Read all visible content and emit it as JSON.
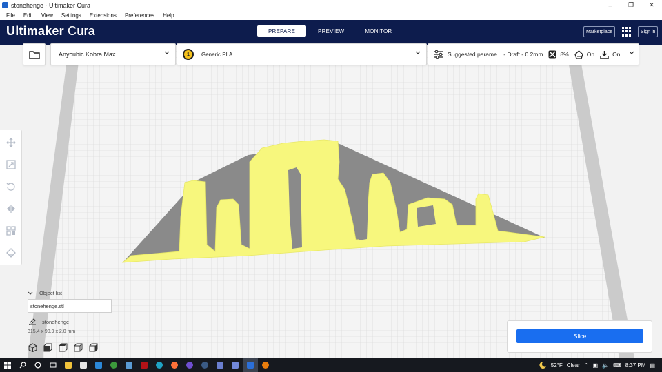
{
  "window": {
    "title": "stonehenge - Ultimaker Cura"
  },
  "menu": [
    "File",
    "Edit",
    "View",
    "Settings",
    "Extensions",
    "Preferences",
    "Help"
  ],
  "header": {
    "brand_bold": "Ultimaker",
    "brand_light": "Cura",
    "tabs": [
      "PREPARE",
      "PREVIEW",
      "MONITOR"
    ],
    "active_tab": "PREPARE",
    "marketplace": "Marketplace",
    "sign_in": "Sign in"
  },
  "stage": {
    "printer": "Anycubic Kobra Max",
    "extruder_number": "1",
    "material": "Generic PLA",
    "profile": "Suggested parame... - Draft - 0.2mm",
    "infill": "8%",
    "support": "On",
    "adhesion": "On"
  },
  "toolbar": {
    "tools": [
      "move-icon",
      "scale-icon",
      "rotate-icon",
      "mirror-icon",
      "per-model-settings-icon",
      "support-blocker-icon"
    ]
  },
  "object_list": {
    "label": "Object list",
    "file": "stonehenge.stl",
    "object_name": "stonehenge",
    "dimensions": "315.4 x 90.9 x 2.0 mm"
  },
  "slice": {
    "label": "Slice"
  },
  "taskbar": {
    "temperature": "52°F",
    "weather": "Clear",
    "time": "8:37 PM"
  },
  "colors": {
    "header_bg": "#0d1c4d",
    "accent_blue": "#196ef0",
    "model_yellow": "#f7f77d",
    "model_shadow": "#8a8a8a",
    "extruder_yellow": "#f6c21c"
  }
}
